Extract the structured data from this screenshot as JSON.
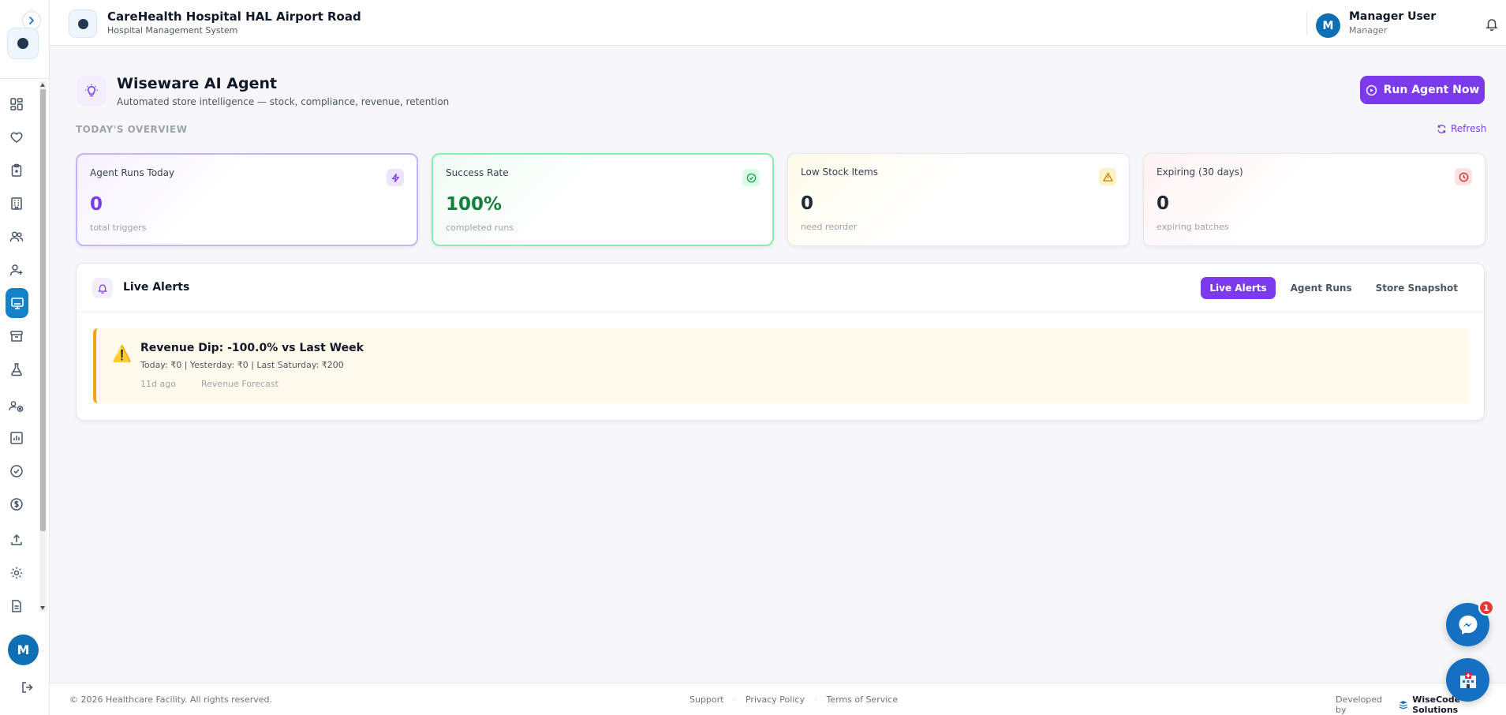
{
  "header": {
    "hospital_name": "CareHealth Hospital HAL Airport Road",
    "subtitle": "Hospital Management System",
    "user_initial": "M",
    "user_name": "Manager User",
    "user_role": "Manager"
  },
  "sidebar": {
    "avatar_initial": "M",
    "items": [
      {
        "icon": "dashboard-grid-icon"
      },
      {
        "icon": "heart-icon"
      },
      {
        "icon": "clipboard-icon"
      },
      {
        "icon": "building-icon"
      },
      {
        "icon": "users-icon"
      },
      {
        "icon": "user-plus-icon"
      },
      {
        "icon": "monitor-icon",
        "active": true
      },
      {
        "icon": "archive-icon"
      },
      {
        "icon": "flask-icon"
      },
      {
        "icon": "users-settings-icon"
      },
      {
        "icon": "bar-chart-icon"
      },
      {
        "icon": "check-circle-icon"
      },
      {
        "icon": "dollar-circle-icon"
      },
      {
        "icon": "upload-icon"
      },
      {
        "icon": "gear-icon"
      },
      {
        "icon": "document-icon"
      }
    ]
  },
  "page": {
    "title": "Wiseware AI Agent",
    "subtitle": "Automated store intelligence — stock, compliance, revenue, retention",
    "run_button": "Run Agent Now",
    "overview_label": "TODAY'S OVERVIEW",
    "refresh_label": "Refresh"
  },
  "stats": [
    {
      "label": "Agent Runs Today",
      "value": "0",
      "note": "total triggers",
      "accent": "#7c3aed"
    },
    {
      "label": "Success Rate",
      "value": "100%",
      "note": "completed runs",
      "accent": "#15803d"
    },
    {
      "label": "Low Stock Items",
      "value": "0",
      "note": "need reorder",
      "accent": "#1f2937"
    },
    {
      "label": "Expiring (30 days)",
      "value": "0",
      "note": "expiring batches",
      "accent": "#1f2937"
    }
  ],
  "alerts_panel": {
    "title": "Live Alerts",
    "tabs": [
      "Live Alerts",
      "Agent Runs",
      "Store Snapshot"
    ],
    "active_tab": "Live Alerts",
    "alerts": [
      {
        "title": "Revenue Dip: -100.0% vs Last Week",
        "detail": "Today: ₹0 | Yesterday: ₹0 | Last Saturday: ₹200",
        "time": "11d ago",
        "source": "Revenue Forecast"
      }
    ]
  },
  "footer": {
    "copyright": "© 2026 Healthcare Facility. All rights reserved.",
    "links": [
      "Support",
      "Privacy Policy",
      "Terms of Service"
    ],
    "dev_prefix": "Developed by",
    "dev_name": "WiseCode Solutions"
  },
  "floating": {
    "chat_badge": "1"
  },
  "colors": {
    "primary": "#7c3aed",
    "brand_blue": "#1581c6",
    "success": "#15803d",
    "warning": "#f2a11a"
  }
}
